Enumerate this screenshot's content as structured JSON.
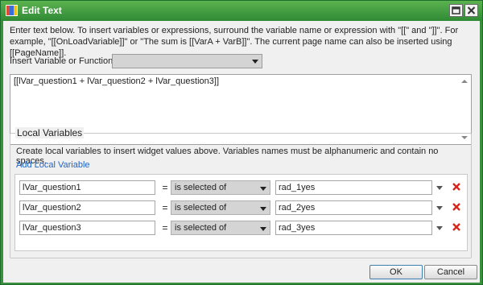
{
  "window": {
    "title": "Edit Text",
    "icon": "edit-text-app-icon",
    "buttons": [
      "maximize-icon",
      "close-icon"
    ]
  },
  "intro": "Enter text below. To insert variables or expressions, surround the variable name or expression with \"[[\" and \"]]\". For example, \"[[OnLoadVariable]]\" or \"The sum is [[VarA + VarB]]\". The current page name can also be inserted using [[PageName]].",
  "insert": {
    "label": "Insert Variable or Function:",
    "value": ""
  },
  "editor": {
    "text": "[[lVar_question1 + lVar_question2 + lVar_question3]]"
  },
  "local_vars": {
    "title": "Local Variables",
    "description": "Create local variables to insert widget values above. Variables names must be alphanumeric and contain no spaces.",
    "add_label": "Add Local Variable",
    "rows": [
      {
        "name": "lVar_question1",
        "eq": "=",
        "op": "is selected of",
        "value": "rad_1yes"
      },
      {
        "name": "lVar_question2",
        "eq": "=",
        "op": "is selected of",
        "value": "rad_2yes"
      },
      {
        "name": "lVar_question3",
        "eq": "=",
        "op": "is selected of",
        "value": "rad_3yes"
      }
    ]
  },
  "footer": {
    "ok_label": "OK",
    "cancel_label": "Cancel"
  },
  "colors": {
    "titlebar": "#3c8f3f",
    "link": "#1e64c8",
    "delete": "#d9261c"
  }
}
